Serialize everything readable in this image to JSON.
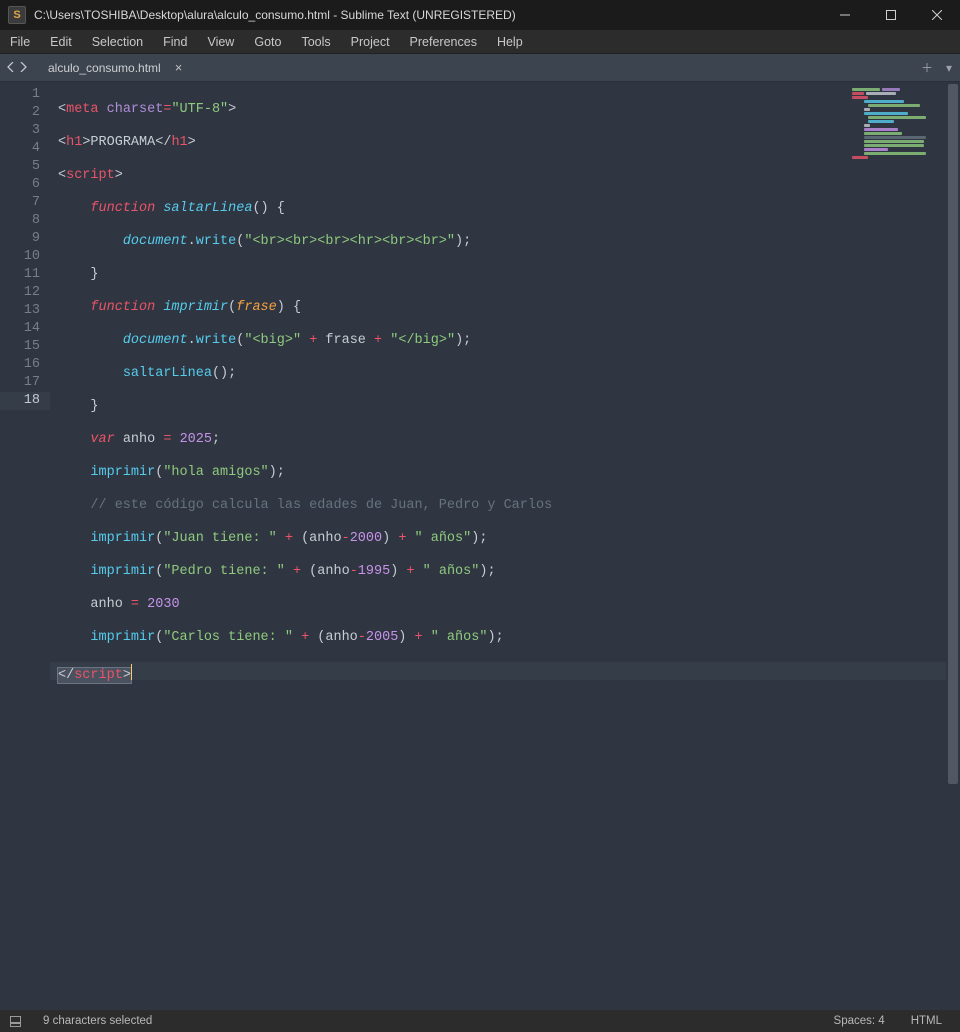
{
  "titlebar": {
    "title": "C:\\Users\\TOSHIBA\\Desktop\\alura\\alculo_consumo.html - Sublime Text (UNREGISTERED)",
    "app_icon_letter": "S"
  },
  "menubar": {
    "items": [
      {
        "label": "File"
      },
      {
        "label": "Edit"
      },
      {
        "label": "Selection"
      },
      {
        "label": "Find"
      },
      {
        "label": "View"
      },
      {
        "label": "Goto"
      },
      {
        "label": "Tools"
      },
      {
        "label": "Project"
      },
      {
        "label": "Preferences"
      },
      {
        "label": "Help"
      }
    ]
  },
  "tabstrip": {
    "tabs": [
      {
        "label": "alculo_consumo.html"
      }
    ]
  },
  "editor": {
    "total_lines": 18,
    "current_line": 18,
    "selection_line": 18,
    "tokens": {
      "line1": {
        "tag_open": "<",
        "meta": "meta",
        "sp": " ",
        "attr": "charset",
        "eq": "=",
        "val": "\"UTF-8\"",
        "tag_close": ">"
      },
      "line2": {
        "o": "<",
        "h1": "h1",
        "c": ">",
        "txt": "PROGRAMA",
        "o2": "</",
        "h1b": "h1",
        "c2": ">"
      },
      "line3": {
        "o": "<",
        "script": "script",
        "c": ">"
      },
      "line4": {
        "indent": "    ",
        "kw": "function",
        "sp": " ",
        "fname": "saltarLinea",
        "paren": "() {",
        "open": ""
      },
      "line5": {
        "indent": "        ",
        "obj": "document",
        "dot": ".",
        "call": "write",
        "open": "(",
        "str": "\"<br><br><br><hr><br><br>\"",
        "close": ");"
      },
      "line6": {
        "indent": "    ",
        "brace": "}"
      },
      "line7": {
        "indent": "    ",
        "kw": "function",
        "sp": " ",
        "fname": "imprimir",
        "open": "(",
        "param": "frase",
        "close": ") {"
      },
      "line8": {
        "indent": "        ",
        "obj": "document",
        "dot": ".",
        "call": "write",
        "open": "(",
        "str1": "\"<big>\"",
        "sp1": " ",
        "op1": "+",
        "sp2": " ",
        "ident": "frase",
        "sp3": " ",
        "op2": "+",
        "sp4": " ",
        "str2": "\"</big>\"",
        "close": ");"
      },
      "line9": {
        "indent": "        ",
        "call": "saltarLinea",
        "rest": "();"
      },
      "line10": {
        "indent": "    ",
        "brace": "}"
      },
      "line11": {
        "indent": "    ",
        "kw": "var",
        "sp": " ",
        "ident": "anho",
        "sp2": " ",
        "eq": "=",
        "sp3": " ",
        "num": "2025",
        "semi": ";"
      },
      "line12": {
        "indent": "    ",
        "call": "imprimir",
        "open": "(",
        "str": "\"hola amigos\"",
        "close": ");"
      },
      "line13": {
        "indent": "    ",
        "cmt": "// este código calcula las edades de Juan, Pedro y Carlos"
      },
      "line14": {
        "indent": "    ",
        "call": "imprimir",
        "open": "(",
        "str1": "\"Juan tiene: \"",
        "sp1": " ",
        "op1": "+",
        "sp2": " (",
        "ident": "anho",
        "minus": "-",
        "num": "2000",
        "paren": ")",
        "sp3": " ",
        "op2": "+",
        "sp4": " ",
        "str2": "\" años\"",
        "close": ");"
      },
      "line15": {
        "indent": "    ",
        "call": "imprimir",
        "open": "(",
        "str1": "\"Pedro tiene: \"",
        "sp1": " ",
        "op1": "+",
        "sp2": " (",
        "ident": "anho",
        "minus": "-",
        "num": "1995",
        "paren": ")",
        "sp3": " ",
        "op2": "+",
        "sp4": " ",
        "str2": "\" años\"",
        "close": ");"
      },
      "line16": {
        "indent": "    ",
        "ident": "anho",
        "sp": " ",
        "eq": "=",
        "sp2": " ",
        "num": "2030"
      },
      "line17": {
        "indent": "    ",
        "call": "imprimir",
        "open": "(",
        "str1": "\"Carlos tiene: \"",
        "sp1": " ",
        "op1": "+",
        "sp2": " (",
        "ident": "anho",
        "minus": "-",
        "num": "2005",
        "paren": ")",
        "sp3": " ",
        "op2": "+",
        "sp4": " ",
        "str2": "\" años\"",
        "close": ");"
      },
      "line18": {
        "sel_open": "</",
        "sel_tag": "script",
        "sel_close": ">"
      }
    }
  },
  "status": {
    "selection": "9 characters selected",
    "spaces": "Spaces: 4",
    "syntax": "HTML"
  }
}
